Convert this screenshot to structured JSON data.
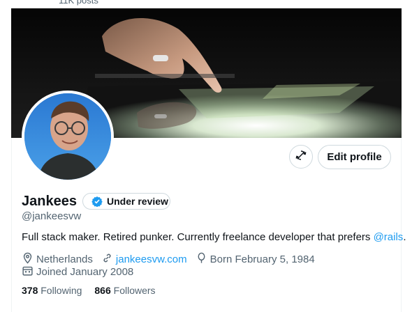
{
  "header": {
    "post_count": "11K posts"
  },
  "profile": {
    "display_name": "Jankees",
    "badge_label": "Under review",
    "handle": "@jankeesvw",
    "bio_text": "Full stack maker. Retired punker. Currently freelance developer that prefers ",
    "bio_mention": "@rails",
    "bio_end": ".",
    "location": "Netherlands",
    "website": "jankeesvw.com",
    "birthday": "Born February 5, 1984",
    "joined": "Joined January 2008",
    "following_count": "378",
    "following_label": "Following",
    "followers_count": "866",
    "followers_label": "Followers"
  },
  "actions": {
    "edit_profile_label": "Edit profile"
  },
  "icons": {
    "verified": "verified-badge-icon",
    "location": "location-pin-icon",
    "website": "link-icon",
    "birthday": "balloon-icon",
    "joined": "calendar-icon",
    "more": "no-sync-icon"
  },
  "colors": {
    "accent": "#1d9bf0",
    "secondary_text": "#536471",
    "border": "#cfd9de"
  }
}
